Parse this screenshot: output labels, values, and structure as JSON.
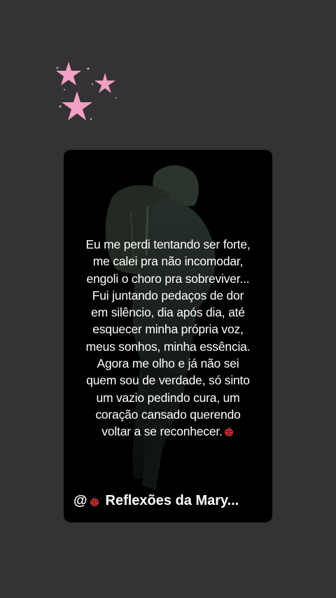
{
  "story": {
    "quote_text": "Eu me perdi tentando ser forte,\nme calei pra não incomodar,\nengoli o choro pra sobreviver...\nFui juntando pedaços de dor\nem silêncio, dia após dia, até\nesquecer minha própria voz,\nmeus sonhos, minha essência.\nAgora me olho e já não sei\nquem sou de verdade, só sinto\num vazio pedindo cura, um\ncoração cansado querendo\nvoltar a se reconhecer.",
    "footer_prefix": "@",
    "footer_name": "Reflexões da Mary..."
  },
  "decorations": {
    "sticker": "pink-stars-sticker",
    "quote_emoji": "ladybug-icon",
    "footer_emoji": "ladybug-icon"
  },
  "colors": {
    "background": "#343234",
    "card": "#000000",
    "text": "#ffffff",
    "stars": "#f2a0c4"
  }
}
